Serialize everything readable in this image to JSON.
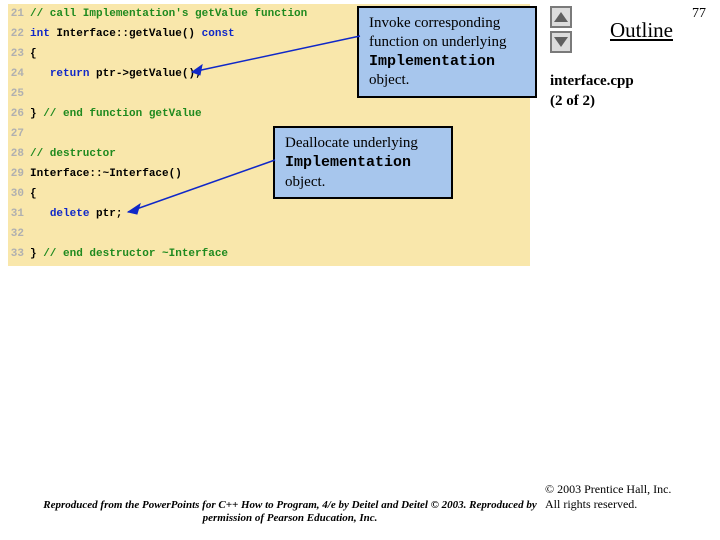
{
  "page_number": "77",
  "outline_label": "Outline",
  "file": {
    "name": "interface.cpp",
    "part": "(2 of 2)"
  },
  "code": [
    {
      "n": "21",
      "spans": [
        {
          "cls": "c-comment",
          "t": "// call Implementation's getValue function"
        }
      ]
    },
    {
      "n": "22",
      "spans": [
        {
          "cls": "c-kw",
          "t": "int"
        },
        {
          "cls": "c-plain",
          "t": " Interface::getValue() "
        },
        {
          "cls": "c-kw",
          "t": "const"
        }
      ]
    },
    {
      "n": "23",
      "spans": [
        {
          "cls": "c-plain",
          "t": "{"
        }
      ]
    },
    {
      "n": "24",
      "spans": [
        {
          "cls": "c-plain",
          "t": "   "
        },
        {
          "cls": "c-kw",
          "t": "return"
        },
        {
          "cls": "c-plain",
          "t": " ptr->getValue();"
        }
      ]
    },
    {
      "n": "25",
      "spans": []
    },
    {
      "n": "26",
      "spans": [
        {
          "cls": "c-plain",
          "t": "} "
        },
        {
          "cls": "c-comment",
          "t": "// end function getValue"
        }
      ]
    },
    {
      "n": "27",
      "spans": []
    },
    {
      "n": "28",
      "spans": [
        {
          "cls": "c-comment",
          "t": "// destructor"
        }
      ]
    },
    {
      "n": "29",
      "spans": [
        {
          "cls": "c-plain",
          "t": "Interface::~Interface()"
        }
      ]
    },
    {
      "n": "30",
      "spans": [
        {
          "cls": "c-plain",
          "t": "{"
        }
      ]
    },
    {
      "n": "31",
      "spans": [
        {
          "cls": "c-plain",
          "t": "   "
        },
        {
          "cls": "c-kw",
          "t": "delete"
        },
        {
          "cls": "c-plain",
          "t": " ptr;"
        }
      ]
    },
    {
      "n": "32",
      "spans": []
    },
    {
      "n": "33",
      "spans": [
        {
          "cls": "c-plain",
          "t": "} "
        },
        {
          "cls": "c-comment",
          "t": "// end destructor ~Interface"
        }
      ]
    }
  ],
  "callouts": {
    "c1": {
      "line1": "Invoke corresponding",
      "line2": "function on underlying",
      "mono": "Implementation",
      "line3tail": " object."
    },
    "c2": {
      "line1": "Deallocate underlying",
      "mono": "Implementation",
      "line2tail": " object."
    }
  },
  "copyright": {
    "l1": "© 2003 Prentice Hall, Inc.",
    "l2": "All rights reserved."
  },
  "repro": "Reproduced from the PowerPoints for C++ How to Program, 4/e by Deitel and Deitel © 2003. Reproduced by permission of Pearson Education, Inc."
}
